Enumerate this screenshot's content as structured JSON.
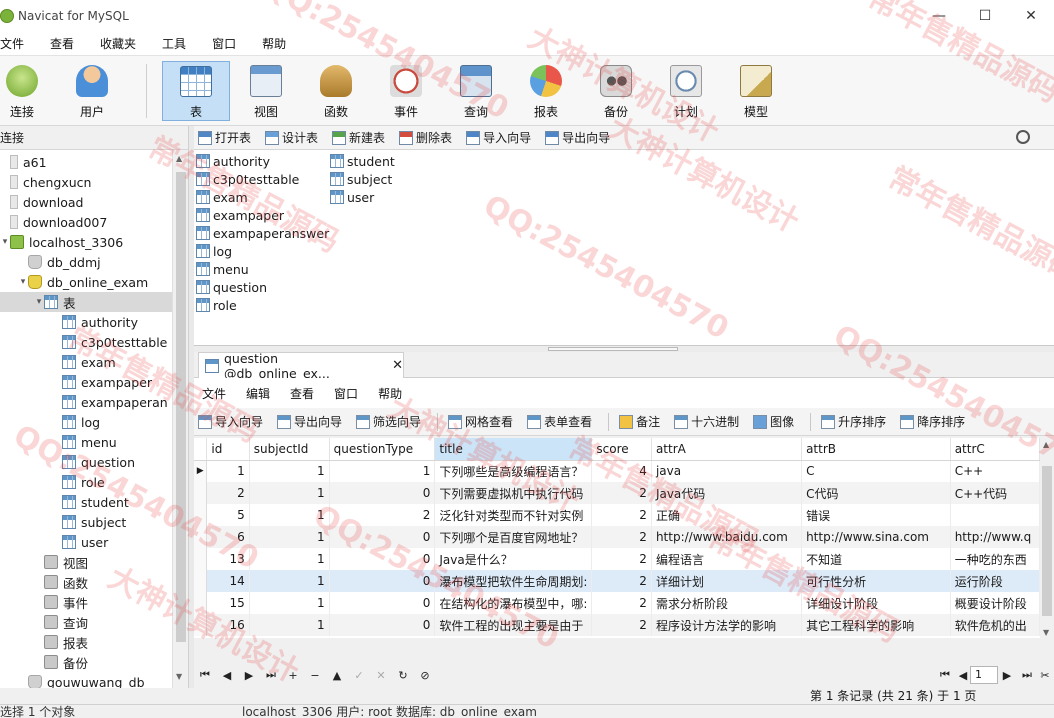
{
  "window": {
    "title": "Navicat for MySQL",
    "minimize": "—",
    "maximize": "☐",
    "close": "✕"
  },
  "menubar": [
    "文件",
    "查看",
    "收藏夹",
    "工具",
    "窗口",
    "帮助"
  ],
  "toolbar": {
    "connect": "连接",
    "user": "用户",
    "table": "表",
    "view": "视图",
    "function": "函数",
    "event": "事件",
    "query": "查询",
    "report": "报表",
    "backup": "备份",
    "schedule": "计划",
    "model": "模型"
  },
  "sidebar": {
    "header": "连接",
    "items": [
      {
        "label": "a61",
        "type": "conn-off",
        "depth": 0,
        "row": 0
      },
      {
        "label": "chengxucn",
        "type": "conn-off",
        "depth": 0,
        "row": 1
      },
      {
        "label": "download",
        "type": "conn-off",
        "depth": 0,
        "row": 2
      },
      {
        "label": "download007",
        "type": "conn-off",
        "depth": 0,
        "row": 3
      },
      {
        "label": "localhost_3306",
        "type": "conn-on",
        "depth": 0,
        "row": 4,
        "expanded": true
      },
      {
        "label": "db_ddmj",
        "type": "db-off",
        "depth": 1,
        "row": 5
      },
      {
        "label": "db_online_exam",
        "type": "db-on",
        "depth": 1,
        "row": 6,
        "expanded": true
      },
      {
        "label": "表",
        "type": "table-folder",
        "depth": 2,
        "row": 7,
        "expanded": true,
        "selected": true
      },
      {
        "label": "authority",
        "type": "table",
        "depth": 3,
        "row": 8
      },
      {
        "label": "c3p0testtable",
        "type": "table",
        "depth": 3,
        "row": 9
      },
      {
        "label": "exam",
        "type": "table",
        "depth": 3,
        "row": 10
      },
      {
        "label": "exampaper",
        "type": "table",
        "depth": 3,
        "row": 11
      },
      {
        "label": "exampaperan",
        "type": "table",
        "depth": 3,
        "row": 12
      },
      {
        "label": "log",
        "type": "table",
        "depth": 3,
        "row": 13
      },
      {
        "label": "menu",
        "type": "table",
        "depth": 3,
        "row": 14
      },
      {
        "label": "question",
        "type": "table",
        "depth": 3,
        "row": 15
      },
      {
        "label": "role",
        "type": "table",
        "depth": 3,
        "row": 16
      },
      {
        "label": "student",
        "type": "table",
        "depth": 3,
        "row": 17
      },
      {
        "label": "subject",
        "type": "table",
        "depth": 3,
        "row": 18
      },
      {
        "label": "user",
        "type": "table",
        "depth": 3,
        "row": 19
      },
      {
        "label": "视图",
        "type": "gen",
        "depth": 2,
        "row": 20
      },
      {
        "label": "函数",
        "type": "gen",
        "depth": 2,
        "row": 21
      },
      {
        "label": "事件",
        "type": "gen",
        "depth": 2,
        "row": 22
      },
      {
        "label": "查询",
        "type": "gen",
        "depth": 2,
        "row": 23
      },
      {
        "label": "报表",
        "type": "gen",
        "depth": 2,
        "row": 24
      },
      {
        "label": "备份",
        "type": "gen",
        "depth": 2,
        "row": 25
      },
      {
        "label": "gouwuwang_db",
        "type": "db-off",
        "depth": 1,
        "row": 26
      }
    ]
  },
  "object_toolbar": [
    "打开表",
    "设计表",
    "新建表",
    "删除表",
    "导入向导",
    "导出向导"
  ],
  "objects": {
    "col1": [
      "authority",
      "c3p0testtable",
      "exam",
      "exampaper",
      "exampaperanswer",
      "log",
      "menu",
      "question",
      "role"
    ],
    "col2": [
      "student",
      "subject",
      "user"
    ]
  },
  "tab": {
    "label": "question @db_online_ex...",
    "close": "✕"
  },
  "submenu": [
    "文件",
    "编辑",
    "查看",
    "窗口",
    "帮助"
  ],
  "grid_toolbar": [
    "导入向导",
    "导出向导",
    "筛选向导",
    "网格查看",
    "表单查看",
    "备注",
    "十六进制",
    "图像",
    "升序排序",
    "降序排序"
  ],
  "grid": {
    "columns": [
      "id",
      "subjectId",
      "questionType",
      "title",
      "score",
      "attrA",
      "attrB",
      "attrC"
    ],
    "rows": [
      [
        "1",
        "1",
        "1",
        "下列哪些是高级编程语言？",
        "4",
        "java",
        "C",
        "C++"
      ],
      [
        "2",
        "1",
        "0",
        "下列需要虚拟机中执行代码",
        "2",
        "Java代码",
        "C代码",
        "C++代码"
      ],
      [
        "5",
        "1",
        "2",
        "泛化针对类型而不针对实例",
        "2",
        "正确",
        "错误",
        ""
      ],
      [
        "6",
        "1",
        "0",
        "下列哪个是百度官网地址？",
        "2",
        "http://www.baidu.com",
        "http://www.sina.com",
        "http://www.q"
      ],
      [
        "13",
        "1",
        "0",
        "Java是什么？",
        "2",
        "编程语言",
        "不知道",
        "一种吃的东西"
      ],
      [
        "14",
        "1",
        "0",
        "瀑布模型把软件生命周期划:",
        "2",
        "详细计划",
        "可行性分析",
        "运行阶段"
      ],
      [
        "15",
        "1",
        "0",
        "在结构化的瀑布模型中，哪:",
        "2",
        "需求分析阶段",
        "详细设计阶段",
        "概要设计阶段"
      ],
      [
        "16",
        "1",
        "0",
        "软件工程的出现主要是由于",
        "2",
        "程序设计方法学的影响",
        "其它工程科学的影响",
        "软件危机的出"
      ]
    ]
  },
  "nav": {
    "page": "1"
  },
  "record_status": "第 1 条记录 (共 21 条) 于 1 页",
  "status": {
    "left": "选择 1 个对象",
    "middle": "localhost_3306   用户: root   数据库: db_online_exam"
  },
  "watermarks": [
    "QQ:2545404570",
    "大神计算机设计",
    "常年售精品源码"
  ]
}
